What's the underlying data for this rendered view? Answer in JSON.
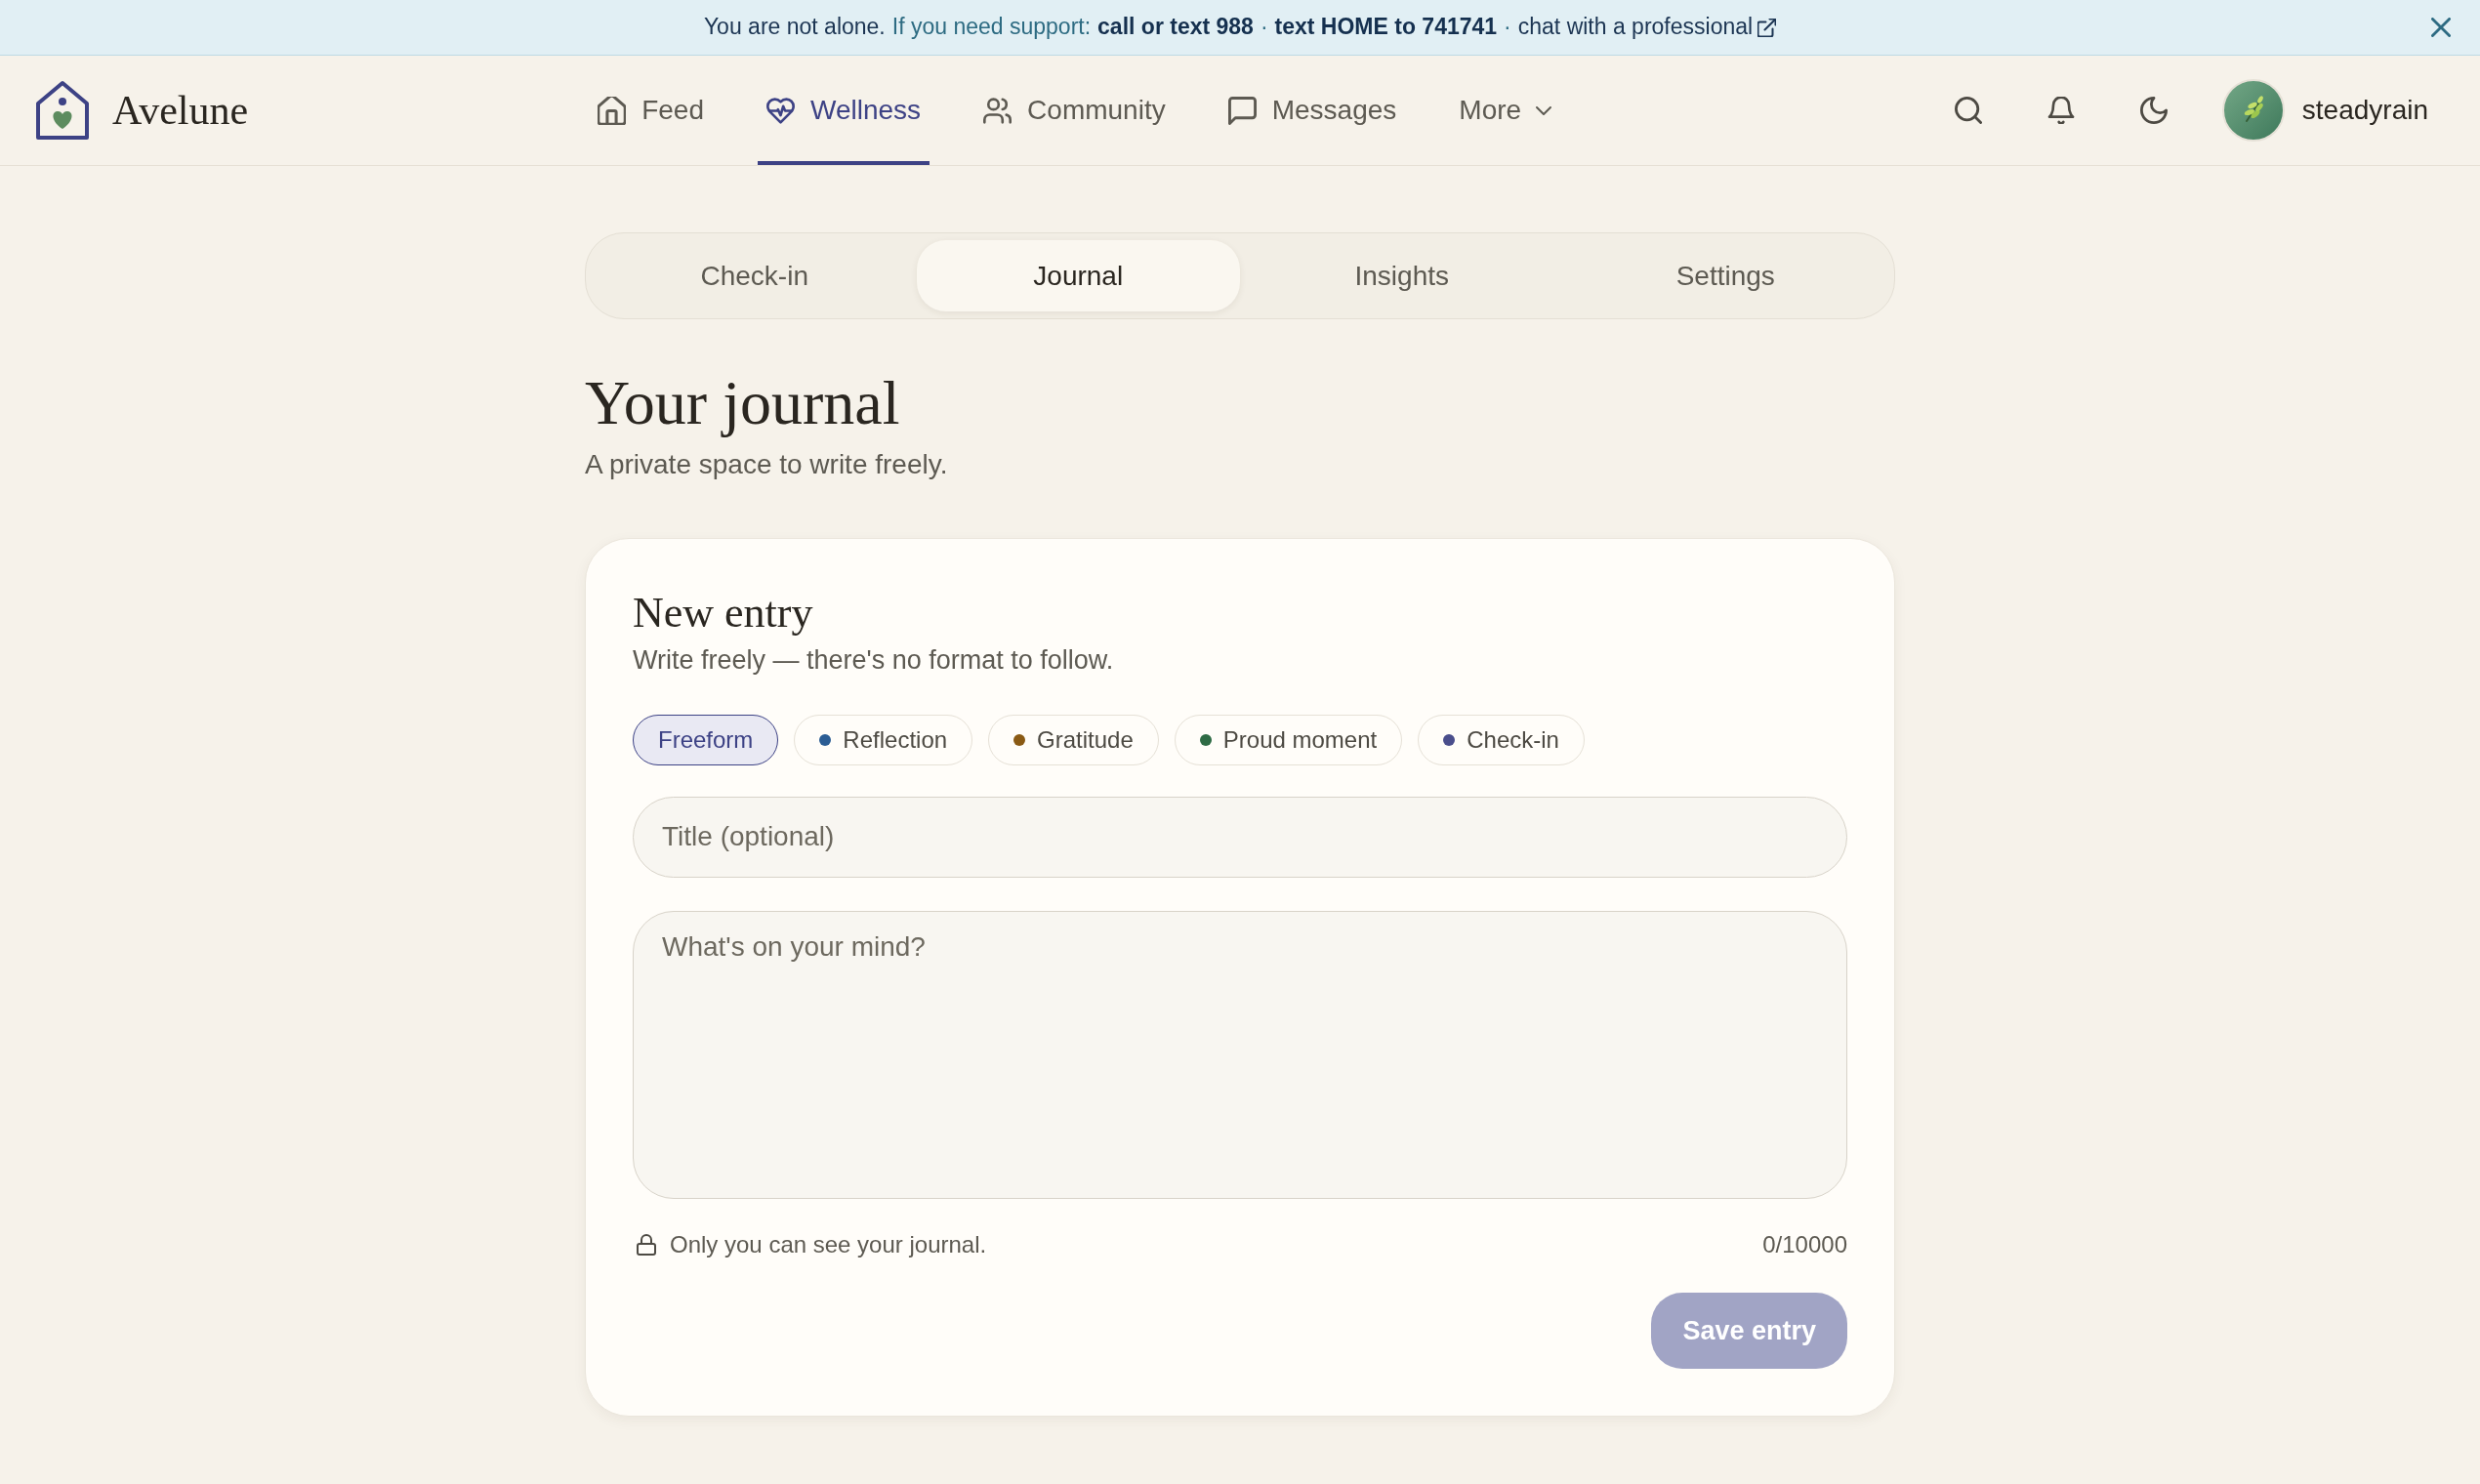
{
  "crisis_banner": {
    "parts": [
      {
        "kind": "lead",
        "text": "You are not alone."
      },
      {
        "kind": "text",
        "text": "If you need support:"
      },
      {
        "kind": "hotline",
        "text": "call or text 988"
      },
      {
        "kind": "separator",
        "text": "·"
      },
      {
        "kind": "hotline",
        "text": "text HOME to 741741"
      },
      {
        "kind": "separator",
        "text": "·"
      },
      {
        "kind": "link",
        "text": "chat with a professional",
        "external": true
      }
    ]
  },
  "navbar": {
    "brand": "Avelune",
    "links": [
      {
        "label": "Feed",
        "kind": "link",
        "selected": false
      },
      {
        "label": "Wellness",
        "kind": "link",
        "selected": true
      },
      {
        "label": "Community",
        "kind": "link",
        "selected": false
      },
      {
        "label": "Messages",
        "kind": "link",
        "selected": false
      },
      {
        "label": "More",
        "kind": "dropdown",
        "selected": false
      }
    ],
    "user": {
      "name": "steadyrain"
    }
  },
  "tabs": [
    {
      "label": "Check-in",
      "selected": false
    },
    {
      "label": "Journal",
      "selected": true
    },
    {
      "label": "Insights",
      "selected": false
    },
    {
      "label": "Settings",
      "selected": false
    }
  ],
  "page_header": {
    "title": "Your journal",
    "subtitle": "A private space to write freely."
  },
  "entry_form": {
    "title": "New entry",
    "subtitle": "Write freely — there's no format to follow.",
    "entry_types": [
      {
        "label": "Freeform",
        "selected": true
      },
      {
        "label": "Reflection",
        "selected": false,
        "color": "#2b5d94"
      },
      {
        "label": "Gratitude",
        "selected": false,
        "color": "#8a5a14"
      },
      {
        "label": "Proud moment",
        "selected": false,
        "color": "#2e6b45"
      },
      {
        "label": "Check-in",
        "selected": false,
        "color": "#4a4e8c"
      }
    ],
    "title_field": {
      "placeholder": "Title (optional)"
    },
    "body_field": {
      "placeholder": "What's on your mind?"
    },
    "privacy_note": "Only you can see your journal.",
    "char_count": "0/10000",
    "save_button": {
      "label": "Save entry",
      "disabled": true
    }
  }
}
